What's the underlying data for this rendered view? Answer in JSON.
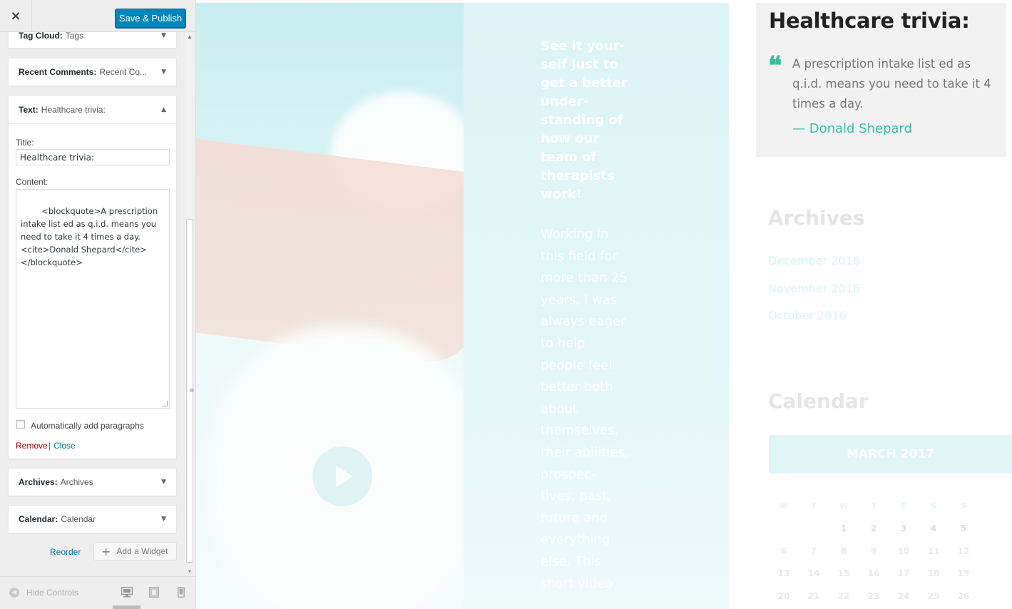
{
  "sidebar": {
    "close_icon": "×",
    "publish_label": "Save & Publish",
    "widgets": {
      "tag_cloud": {
        "name": "Tag Cloud:",
        "title": "Tags"
      },
      "recent_comments": {
        "name": "Recent Comments:",
        "title": "Recent Co..."
      },
      "text": {
        "name": "Text:",
        "title": "Healthcare trivia:",
        "title_label": "Title:",
        "title_value": "Healthcare trivia:",
        "content_label": "Content:",
        "content_value": "<blockquote>A prescription intake list ed as q.i.d. means you need to take it 4 times a day.<cite>Donald Shepard</cite></blockquote>",
        "autop_label": "Automatically add paragraphs",
        "autop_checked": false,
        "remove_label": "Remove",
        "separator": "|",
        "close_label": "Close"
      },
      "archives": {
        "name": "Archives:",
        "title": "Archives"
      },
      "calendar": {
        "name": "Calendar:",
        "title": "Calendar"
      }
    },
    "reorder_label": "Reorder",
    "add_widget_label": "Add a Widget",
    "footer": {
      "hide_controls_label": "Hide Controls",
      "devices": [
        "desktop-icon",
        "tablet-icon",
        "mobile-icon"
      ],
      "active_device": "desktop"
    }
  },
  "preview": {
    "teal_bold_text": "See it your-self just to get a better under-standing of how our team of therapists work!",
    "teal_body_text": "Working in this field for more than 25 years, I was always eager to help people feel better both about themselves, their abilities, prospec-tives, past, future and everything else. This short video",
    "trivia": {
      "title": "Healthcare trivia:",
      "quote_icon": "❝",
      "quote_text": "A prescription intake list ed as q.i.d. means you need to take it 4 times a day.",
      "cite": "— Donald Shepard"
    },
    "archives": {
      "title": "Archives",
      "links": [
        "December 2016",
        "November 2016",
        "October 2016"
      ]
    },
    "calendar": {
      "title": "Calendar",
      "caption": "MARCH 2017",
      "weekdays": [
        "M",
        "T",
        "W",
        "T",
        "F",
        "S",
        "S"
      ],
      "weeks": [
        [
          "",
          "",
          "1",
          "2",
          "3",
          "4",
          "5"
        ],
        [
          "6",
          "7",
          "8",
          "9",
          "10",
          "11",
          "12"
        ],
        [
          "13",
          "14",
          "15",
          "16",
          "17",
          "18",
          "19"
        ],
        [
          "20",
          "21",
          "22",
          "23",
          "24",
          "25",
          "26"
        ]
      ]
    },
    "accent_color": "#3cbd9c",
    "teal_color": "#dcf4f5"
  }
}
